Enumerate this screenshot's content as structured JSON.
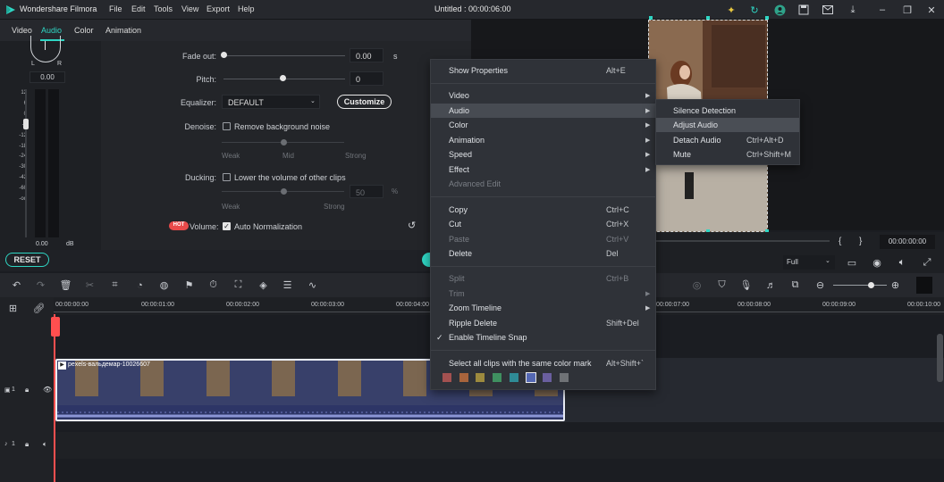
{
  "app": {
    "name": "Wondershare Filmora",
    "doc_title": "Untitled : 00:00:06:00",
    "accent": "#2fd6c4"
  },
  "menubar": [
    "File",
    "Edit",
    "Tools",
    "View",
    "Export",
    "Help"
  ],
  "panel_tabs": [
    "Video",
    "Audio",
    "Color",
    "Animation"
  ],
  "meter": {
    "knob_left": "L",
    "knob_right": "R",
    "pan_value": "0.00",
    "scale": [
      "12",
      "6",
      "0",
      "-6",
      "-12",
      "-18",
      "-24",
      "-30",
      "-42",
      "-60",
      "-oo"
    ],
    "readout": "0.00",
    "unit": "dB"
  },
  "audio": {
    "fade_out_label": "Fade out:",
    "fade_out_value": "0.00",
    "fade_out_unit": "s",
    "pitch_label": "Pitch:",
    "pitch_value": "0",
    "equalizer_label": "Equalizer:",
    "equalizer_value": "DEFAULT",
    "customize": "Customize",
    "denoise_label": "Denoise:",
    "denoise_checkbox": "Remove background noise",
    "denoise_levels": [
      "Weak",
      "Mid",
      "Strong"
    ],
    "ducking_label": "Ducking:",
    "ducking_checkbox": "Lower the volume of other clips",
    "ducking_value": "50",
    "ducking_unit": "%",
    "ducking_levels": [
      "Weak",
      "Strong"
    ],
    "hot_badge": "HOT",
    "volume_label": "Volume:",
    "auto_norm": "Auto Normalization"
  },
  "reset": "RESET",
  "preview": {
    "timecode": "00:00:00:00",
    "quality": "Full",
    "brackets": [
      "{",
      "}"
    ]
  },
  "ruler": [
    "00:00:00:00",
    "00:00:01:00",
    "00:00:02:00",
    "00:00:03:00",
    "00:00:04:00",
    "00:00:07:00",
    "00:00:08:00",
    "00:00:09:00",
    "00:00:10:00"
  ],
  "tracks": {
    "video_num": "1",
    "audio_num": "1",
    "clip_title": "pexels-вальдемар-10026607"
  },
  "context_menu": {
    "items": [
      {
        "label": "Show Properties",
        "shortcut": "Alt+E"
      },
      {
        "label": "Video",
        "arrow": "▶"
      },
      {
        "label": "Audio",
        "arrow": "▶"
      },
      {
        "label": "Color",
        "arrow": "▶"
      },
      {
        "label": "Animation",
        "arrow": "▶"
      },
      {
        "label": "Speed",
        "arrow": "▶"
      },
      {
        "label": "Effect",
        "arrow": "▶"
      },
      {
        "label": "Advanced Edit"
      },
      {
        "label": "Copy",
        "shortcut": "Ctrl+C"
      },
      {
        "label": "Cut",
        "shortcut": "Ctrl+X"
      },
      {
        "label": "Paste",
        "shortcut": "Ctrl+V"
      },
      {
        "label": "Delete",
        "shortcut": "Del"
      },
      {
        "label": "Split",
        "shortcut": "Ctrl+B"
      },
      {
        "label": "Trim",
        "arrow": "▶"
      },
      {
        "label": "Zoom Timeline",
        "arrow": "▶"
      },
      {
        "label": "Ripple Delete",
        "shortcut": "Shift+Del"
      },
      {
        "label": "Enable Timeline Snap",
        "check": "✓"
      },
      {
        "label": "Select all clips with the same color mark",
        "shortcut": "Alt+Shift+`"
      }
    ],
    "swatches": [
      "#a35150",
      "#a8643c",
      "#9d8a3e",
      "#3f9060",
      "#2f8b96",
      "#5468b3",
      "#6a5f9f",
      "#6f7276"
    ]
  },
  "submenu": {
    "items": [
      {
        "label": "Silence Detection"
      },
      {
        "label": "Adjust Audio"
      },
      {
        "label": "Detach Audio",
        "shortcut": "Ctrl+Alt+D"
      },
      {
        "label": "Mute",
        "shortcut": "Ctrl+Shift+M"
      }
    ]
  }
}
